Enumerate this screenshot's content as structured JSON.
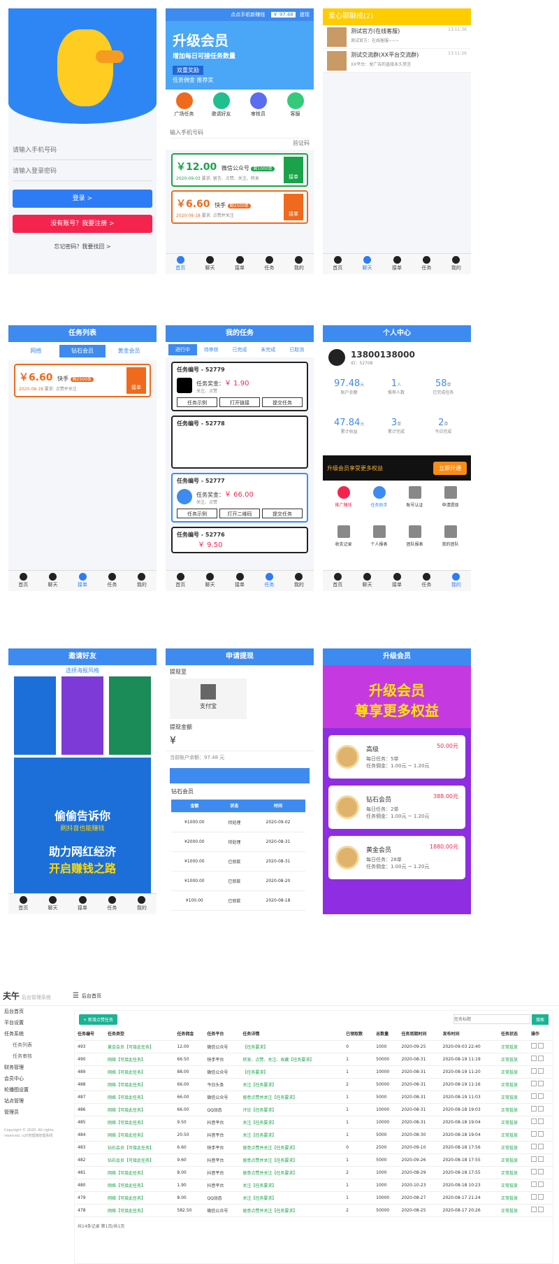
{
  "login": {
    "phone_ph": "请输入手机号码",
    "pwd_ph": "请输入登录密码",
    "login_btn": "登录 >",
    "register_btn": "没有账号？我要注册 >",
    "forgot": "忘记密码？我要找回 >"
  },
  "home": {
    "topbar": "点点手机新赚钱",
    "balance": "￥ 97.48",
    "withdraw": "提现",
    "banner_title": "升级会员",
    "banner_sub": "增加每日可接任务数量",
    "banner_tag": "双重奖励",
    "banner_tag2": "任务佣金  推荐奖",
    "icons": [
      "广场任务",
      "邀请好友",
      "审核员",
      "客服"
    ],
    "phone_ph": "输入手机号码",
    "code_ph": "验证码",
    "tasks": [
      {
        "price": "￥12.00",
        "name": "微信公众号",
        "count": "剩1000单",
        "date": "2020-09-03",
        "desc": "要求: 留言、点赞、关注、转发",
        "btn": "接单"
      },
      {
        "price": "￥6.60",
        "name": "快手",
        "count": "剩2500单",
        "date": "2020-08-18",
        "desc": "要求: 点赞并关注",
        "btn": "接单"
      }
    ]
  },
  "nav": [
    "首页",
    "聊天",
    "接单",
    "任务",
    "我的"
  ],
  "chat": {
    "title": "爱心聊聊成(2)",
    "items": [
      {
        "name": "测试官方(在线客服)",
        "time": "13:11:36",
        "msg": "测试官方：在线客服~~~"
      },
      {
        "name": "测试交流群(XX平台交流群)",
        "time": "13:11:26",
        "msg": "XX平台：发广告的直接永久禁言"
      }
    ]
  },
  "tasklist": {
    "title": "任务列表",
    "tabs": [
      "网络",
      "钻石会员",
      "黄金会员"
    ],
    "task": {
      "price": "￥6.60",
      "name": "快手",
      "count": "剩2500单",
      "date": "2020-08-18",
      "desc": "要求: 点赞并关注",
      "btn": "接单"
    }
  },
  "mytask": {
    "title": "我的任务",
    "tabs": [
      "进行中",
      "待审核",
      "已完成",
      "未完成",
      "已取消"
    ],
    "cards": [
      {
        "no": "任务编号 - 52779",
        "reward_label": "任务奖金：",
        "reward": "￥ 1.90",
        "desc": "关注、点赞",
        "b1": "任务示例",
        "b2": "打开链接",
        "b3": "提交任务"
      },
      {
        "no": "任务编号 - 52778",
        "reward_label": "",
        "reward": "",
        "desc": "",
        "b1": "",
        "b2": "",
        "b3": ""
      },
      {
        "no": "任务编号 - 52777",
        "reward_label": "任务奖金：",
        "reward": "￥ 66.00",
        "desc": "关注、点赞",
        "b1": "任务示例",
        "b2": "打开二维码",
        "b3": "提交任务"
      },
      {
        "no": "任务编号 - 52776",
        "reward_label": "",
        "reward": "￥ 9.50",
        "desc": "",
        "b1": "",
        "b2": "",
        "b3": ""
      }
    ]
  },
  "profile": {
    "title": "个人中心",
    "phone": "13800138000",
    "id_label": "ID：",
    "id": "52708",
    "stats": [
      {
        "v": "97.48",
        "u": "元",
        "l": "账户余额"
      },
      {
        "v": "1",
        "u": "人",
        "l": "推荐人数"
      },
      {
        "v": "58",
        "u": "单",
        "l": "已完成任务"
      },
      {
        "v": "47.84",
        "u": "元",
        "l": "累计收益"
      },
      {
        "v": "3",
        "u": "单",
        "l": "累计完成"
      },
      {
        "v": "2",
        "u": "单",
        "l": "今日完成"
      }
    ],
    "vip_text": "升级会员享受更多权益",
    "vip_btn": "立即开通",
    "menu": [
      "推广赚钱",
      "任务助手",
      "账号认证",
      "申请提现",
      "收支记录",
      "个人报表",
      "团队报表",
      "我的团队"
    ]
  },
  "invite": {
    "title": "邀请好友",
    "sub": "选择海报风格",
    "poster_big1": "偷偷告诉你",
    "poster_big2": "刷抖音也能赚钱",
    "poster_big3": "助力网红经济",
    "poster_big4": "开启赚钱之路"
  },
  "withdraw": {
    "title": "申请提现",
    "method_label": "提现至",
    "method": "支付宝",
    "amount_label": "提现金额",
    "currency": "¥",
    "balance": "当前账户余额：97.48 元",
    "member": "钻石会员",
    "table_head": [
      "金额",
      "状态",
      "时间"
    ],
    "rows": [
      [
        "¥1000.00",
        "待处理",
        "2020-09-02"
      ],
      [
        "¥2000.00",
        "待处理",
        "2020-08-31"
      ],
      [
        "¥1000.00",
        "已驳款",
        "2020-08-31"
      ],
      [
        "¥1000.00",
        "已驳款",
        "2020-08-20"
      ],
      [
        "¥100.00",
        "已驳款",
        "2020-08-18"
      ]
    ]
  },
  "upgrade": {
    "title": "升级会员",
    "banner1": "升级会员",
    "banner2": "尊享更多权益",
    "levels": [
      {
        "name": "高级",
        "price": "50.00元",
        "daily": "每日任务：5单",
        "comm": "任务佣金：1.00元 ~ 1.20元"
      },
      {
        "name": "钻石会员",
        "price": "388.00元",
        "daily": "每日任务：2单",
        "comm": "任务佣金：1.00元 ~ 1.20元"
      },
      {
        "name": "黄金会员",
        "price": "1880.00元",
        "daily": "每日任务：28单",
        "comm": "任务佣金：1.00元 ~ 1.20元"
      }
    ]
  },
  "admin": {
    "logo": "夫午",
    "logo_sub": "后台管理系统",
    "breadcrumb": "后台首页",
    "add_btn": "+ 新增点赞任务",
    "search_ph": "任务标题",
    "search_btn": "搜索",
    "side": [
      "后台首页",
      "平台设置",
      "任务系统",
      "任务列表",
      "任务审核",
      "财务管理",
      "会员中心",
      "轮播图设置",
      "站点管理",
      "管理员"
    ],
    "copyright": "Copyright © 2020. All rights reserved. v20管理端管理系统",
    "cols": [
      "任务编号",
      "任务类型",
      "任务佣金",
      "任务平台",
      "任务详情",
      "已领取数",
      "总数量",
      "任务到期时间",
      "发布时间",
      "任务状态",
      "操作"
    ],
    "rows": [
      [
        "493",
        "黄金会员【可接此任务】",
        "12.00",
        "微信公众号",
        "【任务要求】",
        "0",
        "1000",
        "2020-09-25",
        "2020-09-03 22:40",
        "正常投放"
      ],
      [
        "490",
        "网络【可接此任务】",
        "66.50",
        "快手平台",
        "转发、点赞、关注、收藏【任务要求】",
        "1",
        "50000",
        "2020-08-31",
        "2020-08-19 11:19",
        "正常投放"
      ],
      [
        "489",
        "网络【可接此任务】",
        "88.00",
        "微信公众号",
        "【任务要求】",
        "1",
        "10000",
        "2020-08-31",
        "2020-08-19 11:20",
        "正常投放"
      ],
      [
        "488",
        "网络【可接此任务】",
        "66.00",
        "今日头条",
        "关注【任务要求】",
        "2",
        "50000",
        "2020-08-31",
        "2020-08-19 11:16",
        "正常投放"
      ],
      [
        "487",
        "网络【可接此任务】",
        "66.00",
        "微信公众号",
        "留意点赞并关注【任务要求】",
        "1",
        "5000",
        "2020-08-31",
        "2020-08-19 11:03",
        "正常投放"
      ],
      [
        "486",
        "网络【可接此任务】",
        "66.00",
        "QQ动态",
        "评论【任务要求】",
        "1",
        "10000",
        "2020-08-31",
        "2020-08-18 19:03",
        "正常投放"
      ],
      [
        "485",
        "网络【可接此任务】",
        "9.50",
        "抖音平台",
        "关注【任务要求】",
        "1",
        "10000",
        "2020-08-31",
        "2020-08-18 19:04",
        "正常投放"
      ],
      [
        "484",
        "网络【可接此任务】",
        "20.50",
        "抖音平台",
        "关注【任务要求】",
        "1",
        "5000",
        "2020-08-30",
        "2020-08-18 19:04",
        "正常投放"
      ],
      [
        "483",
        "钻石会员【可接此任务】",
        "6.60",
        "快手平台",
        "留意点赞并关注【任务要求】",
        "0",
        "2500",
        "2020-09-10",
        "2020-08-18 17:56",
        "正常投放"
      ],
      [
        "482",
        "钻石会员【可接此任务】",
        "9.60",
        "抖音平台",
        "留意点赞并关注【任务要求】",
        "1",
        "5000",
        "2020-09-26",
        "2020-08-18 17:55",
        "正常投放"
      ],
      [
        "481",
        "网络【可接此任务】",
        "8.00",
        "抖音平台",
        "留意点赞并关注【任务要求】",
        "2",
        "1000",
        "2020-08-29",
        "2020-08-18 17:55",
        "正常投放"
      ],
      [
        "480",
        "网络【可接此任务】",
        "1.90",
        "抖音平台",
        "关注【任务要求】",
        "1",
        "1000",
        "2020-10-23",
        "2020-08-18 10:23",
        "正常投放"
      ],
      [
        "479",
        "网络【可接此任务】",
        "8.00",
        "QQ动态",
        "关注【任务要求】",
        "1",
        "10000",
        "2020-08-27",
        "2020-08-17 21:24",
        "正常投放"
      ],
      [
        "478",
        "网络【可接此任务】",
        "582.50",
        "微信公众号",
        "留意点赞并关注【任务要求】",
        "2",
        "50000",
        "2020-08-25",
        "2020-08-17 20:26",
        "正常投放"
      ]
    ],
    "footer": "共14条记录 第1页/共1页"
  },
  "colors": {
    "blue": "#3d8bf0",
    "red": "#f5244e",
    "green": "#1aa34a",
    "orange": "#f06a1d",
    "purple": "#8a2be2"
  }
}
